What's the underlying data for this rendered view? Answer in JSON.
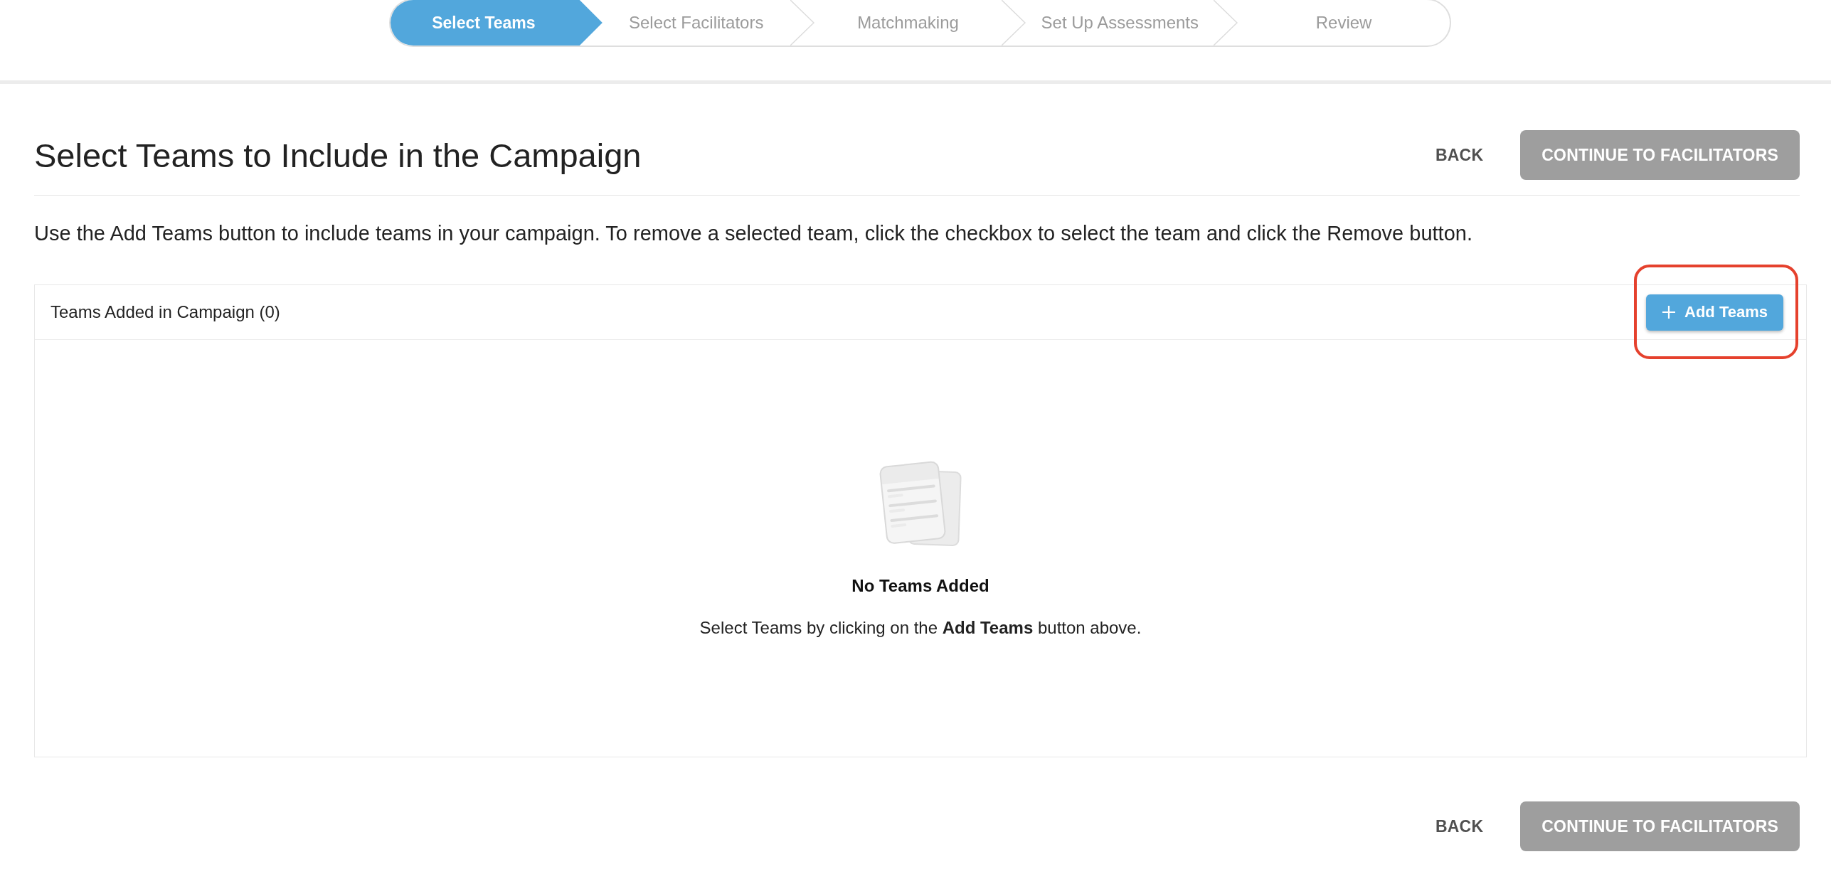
{
  "stepper": {
    "steps": [
      {
        "label": "Select Teams",
        "selected": true
      },
      {
        "label": "Select Facilitators",
        "selected": false
      },
      {
        "label": "Matchmaking",
        "selected": false
      },
      {
        "label": "Set Up Assessments",
        "selected": false
      },
      {
        "label": "Review",
        "selected": false
      }
    ]
  },
  "page": {
    "title": "Select Teams to Include in the Campaign",
    "actions": [
      {
        "label": "BACK",
        "kind": "text",
        "disabled": false
      },
      {
        "label": "CONTINUE TO FACILITATORS",
        "kind": "filled",
        "disabled": true
      }
    ],
    "instructions": "Use the Add Teams button to include teams in your campaign. To remove a selected team, click the checkbox to select the team and click the Remove button."
  },
  "teams_panel": {
    "title": "Teams Added in Campaign (0)",
    "add_button": {
      "label": "Add Teams",
      "highlighted": true
    },
    "empty_state": {
      "title": "No Teams Added",
      "message": "Select Teams by clicking on the **Add Teams** button above."
    }
  },
  "footer_actions": [
    {
      "label": "BACK",
      "kind": "text",
      "disabled": false
    },
    {
      "label": "CONTINUE TO FACILITATORS",
      "kind": "filled",
      "disabled": true
    }
  ]
}
